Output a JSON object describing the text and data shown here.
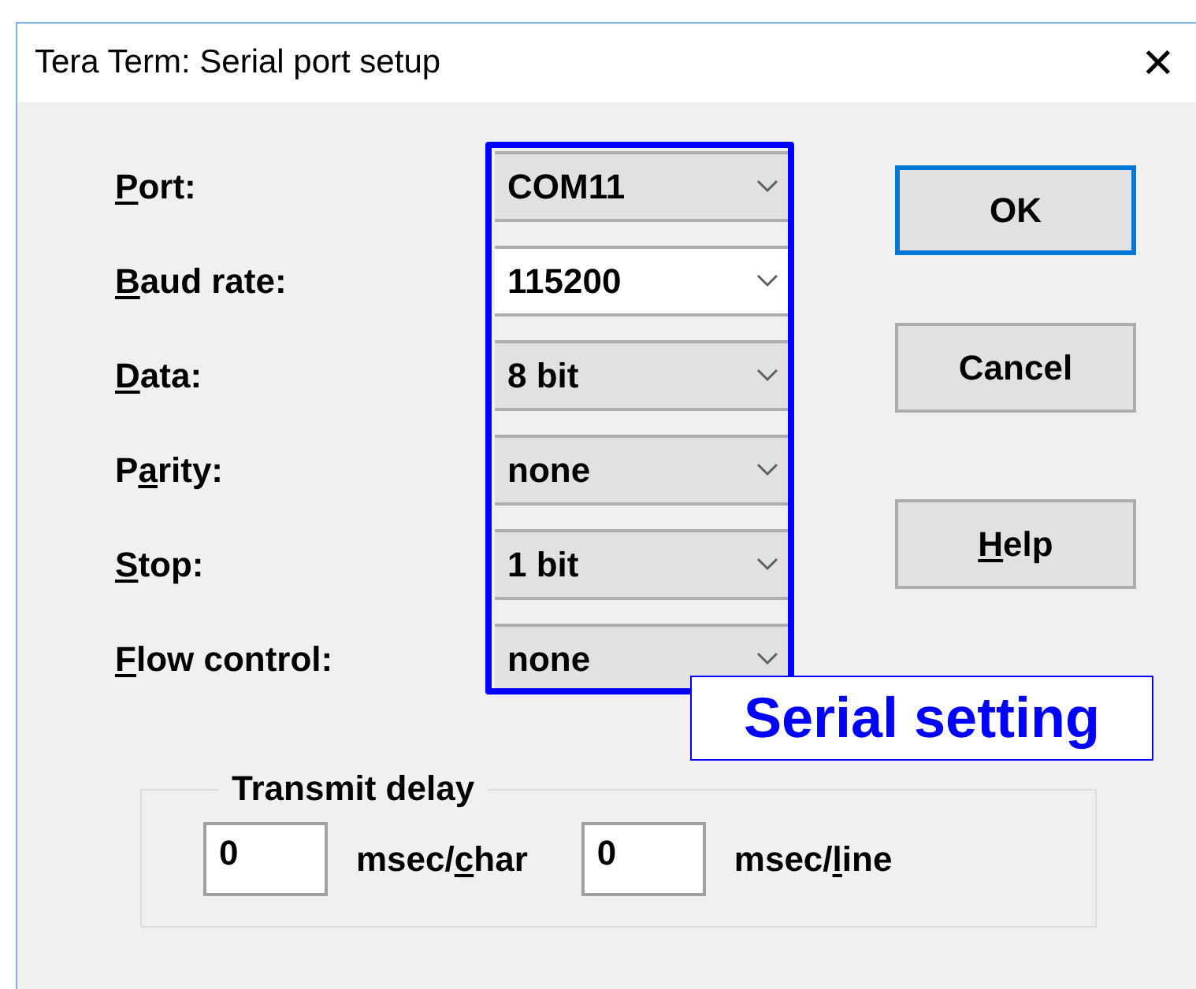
{
  "window": {
    "title": "Tera Term: Serial port setup",
    "close": "✕"
  },
  "settings": [
    {
      "label": {
        "key": "P",
        "after": "ort:"
      },
      "value": "COM11",
      "focused": false
    },
    {
      "label": {
        "key": "B",
        "after": "aud rate:"
      },
      "value": "115200",
      "focused": true
    },
    {
      "label": {
        "key": "D",
        "after": "ata:"
      },
      "value": "8 bit",
      "focused": false
    },
    {
      "label": {
        "before": "P",
        "key": "a",
        "after": "rity:"
      },
      "value": "none",
      "focused": false
    },
    {
      "label": {
        "key": "S",
        "after": "top:"
      },
      "value": "1 bit",
      "focused": false
    },
    {
      "label": {
        "key": "F",
        "after": "low control:"
      },
      "value": "none",
      "focused": false
    }
  ],
  "buttons": [
    {
      "label": {
        "after": "OK"
      },
      "default": true
    },
    {
      "label": {
        "after": "Cancel"
      },
      "default": false
    },
    {
      "label": {
        "key": "H",
        "after": "elp"
      },
      "default": false
    }
  ],
  "annotation": {
    "text": "Serial setting"
  },
  "transmit_delay": {
    "title": "Transmit delay",
    "fields": [
      {
        "value": "0",
        "unit": {
          "before": "msec/",
          "key": "c",
          "after": "har"
        }
      },
      {
        "value": "0",
        "unit": {
          "before": "msec/",
          "key": "l",
          "after": "ine"
        }
      }
    ]
  }
}
